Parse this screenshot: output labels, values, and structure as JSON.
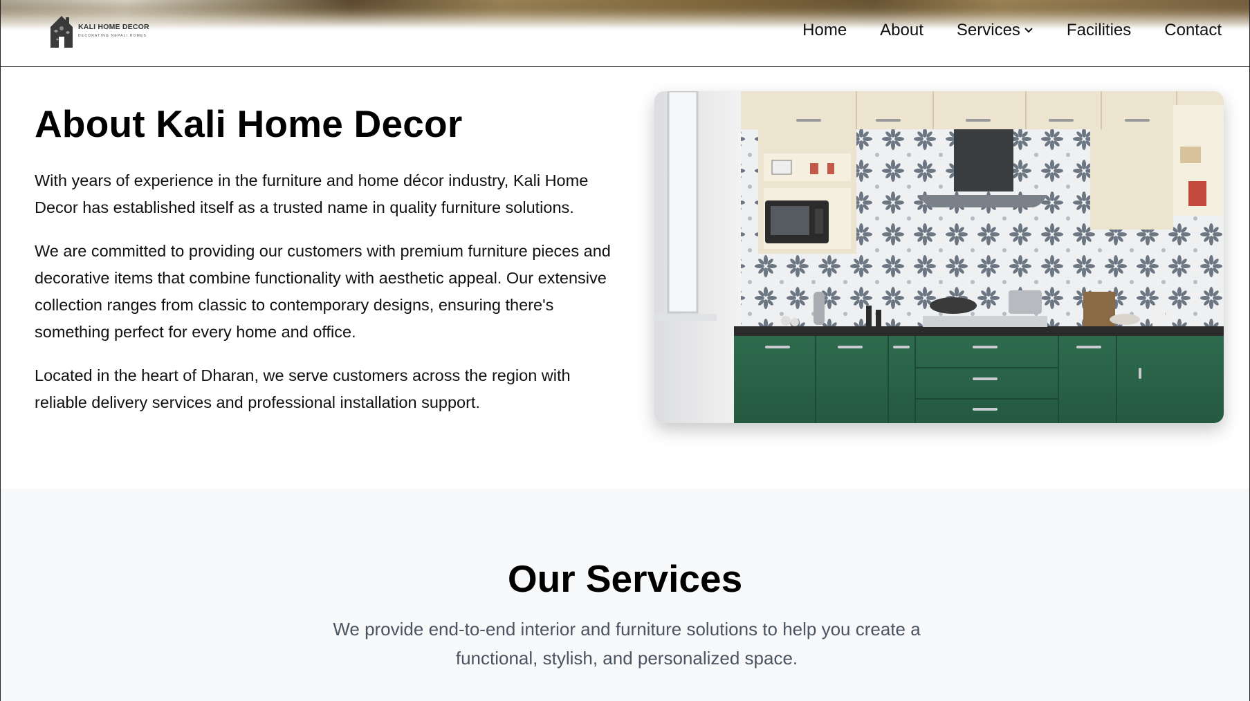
{
  "header": {
    "logo": {
      "name": "KALI HOME DECOR",
      "tagline": "DECORATING NEPALI HOMES"
    },
    "nav": [
      {
        "label": "Home"
      },
      {
        "label": "About"
      },
      {
        "label": "Services"
      },
      {
        "label": "Facilities"
      },
      {
        "label": "Contact"
      }
    ]
  },
  "about": {
    "title": "About Kali Home Decor",
    "paragraphs": [
      "With years of experience in the furniture and home décor industry, Kali Home Decor has established itself as a trusted name in quality furniture solutions.",
      "We are committed to providing our customers with premium furniture pieces and decorative items that combine functionality with aesthetic appeal. Our extensive collection ranges from classic to contemporary designs, ensuring there's something perfect for every home and office.",
      "Located in the heart of Dharan, we serve customers across the region with reliable delivery services and professional installation support."
    ],
    "image": {
      "subject": "modular kitchen with green lower cabinets and patterned tile backsplash"
    }
  },
  "services": {
    "title": "Our Services",
    "subtitle": "We provide end-to-end interior and furniture solutions to help you create a functional, stylish, and personalized space."
  },
  "colors": {
    "accent_green": "#2f6b4f",
    "cabinet_cream": "#ece4cf",
    "services_bg": "#f8f9fb",
    "subtitle_gray": "#4a5360"
  }
}
